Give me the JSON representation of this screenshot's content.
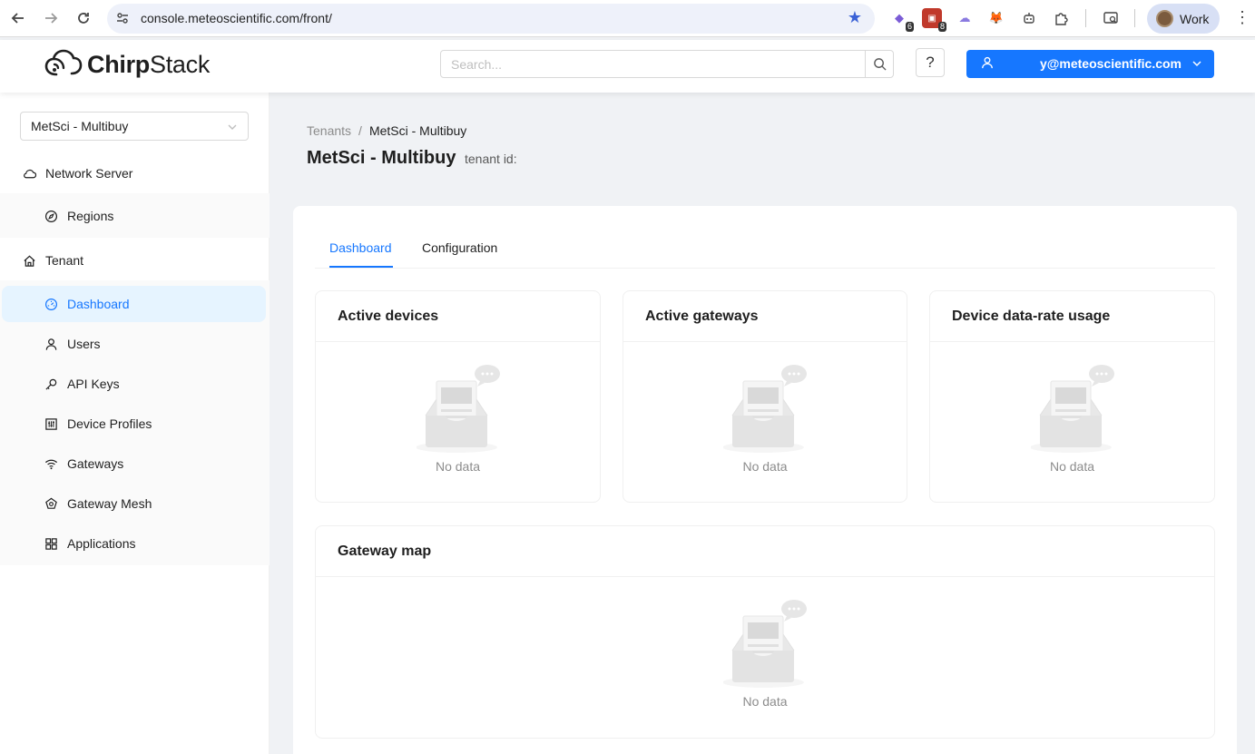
{
  "browser": {
    "url": "console.meteoscientific.com/front/",
    "extensions": [
      {
        "name": "extension-1",
        "badge": "6"
      },
      {
        "name": "extension-2",
        "badge": "8"
      }
    ],
    "profile_label": "Work"
  },
  "header": {
    "logo_text_a": "Chirp",
    "logo_text_b": "Stack",
    "search_placeholder": "Search...",
    "help_label": "?",
    "user_email": "y@meteoscientific.com"
  },
  "sidebar": {
    "tenant_selected": "MetSci - Multibuy",
    "groups": [
      {
        "label": "Network Server",
        "icon": "cloud-icon"
      },
      {
        "label": "Tenant",
        "icon": "home-icon"
      }
    ],
    "items": [
      {
        "label": "Regions",
        "icon": "compass-icon"
      },
      {
        "label": "Dashboard",
        "icon": "dashboard-icon"
      },
      {
        "label": "Users",
        "icon": "user-icon"
      },
      {
        "label": "API Keys",
        "icon": "key-icon"
      },
      {
        "label": "Device Profiles",
        "icon": "control-icon"
      },
      {
        "label": "Gateways",
        "icon": "wifi-icon"
      },
      {
        "label": "Gateway Mesh",
        "icon": "mesh-icon"
      },
      {
        "label": "Applications",
        "icon": "appstore-icon"
      }
    ]
  },
  "main": {
    "breadcrumb": [
      "Tenants",
      "/",
      "MetSci - Multibuy"
    ],
    "title": "MetSci - Multibuy",
    "subtitle": "tenant id:",
    "tabs": [
      "Dashboard",
      "Configuration"
    ],
    "panels": [
      {
        "title": "Active devices",
        "empty": "No data"
      },
      {
        "title": "Active gateways",
        "empty": "No data"
      },
      {
        "title": "Device data-rate usage",
        "empty": "No data"
      },
      {
        "title": "Gateway map",
        "empty": "No data"
      }
    ]
  },
  "colors": {
    "primary": "#1677ff",
    "active_bg": "#e6f4ff",
    "page_bg": "#f0f2f5"
  }
}
